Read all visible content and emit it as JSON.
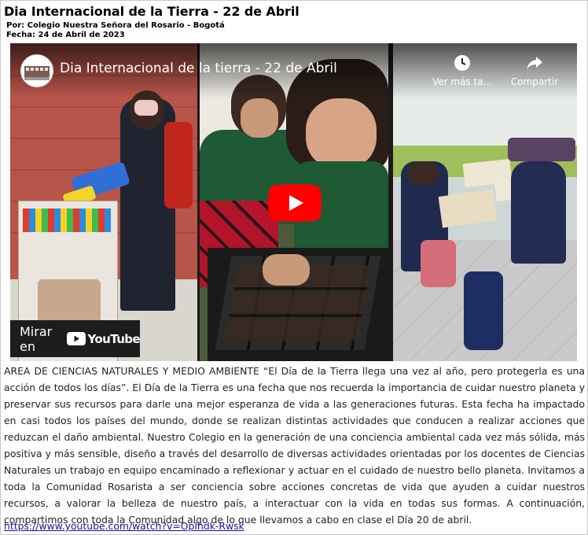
{
  "article": {
    "title": "Dia Internacional de la Tierra - 22 de Abril",
    "author": "Por: Colegio Nuestra Señora del Rosario - Bogotá",
    "date": "Fecha: 24 de Abril de 2023",
    "body": "AREA DE CIENCIAS NATURALES Y MEDIO AMBIENTE “El Día de la Tierra llega una vez al año, pero protegerla es una acción de todos los días”. El Día de la Tierra es una fecha que nos recuerda la importancia de cuidar nuestro planeta y preservar sus recursos para darle una mejor esperanza de vida a las generaciones futuras. Esta fecha ha impactado en casi todos los países del mundo, donde se realizan distintas actividades que conducen a realizar acciones que reduzcan el daño ambiental. Nuestro Colegio en la generación de una conciencia ambiental cada vez más sólida, más positiva y más sensible, diseño a través del desarrollo de diversas actividades orientadas por los docentes de Ciencias Naturales un trabajo en equipo encaminado a reflexionar y actuar en el cuidado de nuestro bello planeta. Invitamos a toda la Comunidad Rosarista a ser conciencia sobre acciones concretas de vida que ayuden a cuidar nuestros recursos, a valorar la belleza de nuestro país, a interactuar con la vida en todas sus formas. A continuación, compartimos con toda la Comunidad algo de lo que llevamos a cabo en clase el Día 20 de abril.",
    "link": "https://www.youtube.com/watch?v=OpIhdk-Rwsk"
  },
  "video": {
    "title": "Dia Internacional de la tierra - 22 de Abril",
    "watch_later_label": "Ver más ta...",
    "share_label": "Compartir",
    "watch_on_label": "Mirar en",
    "youtube_word": "YouTube",
    "icons": [
      "channel-avatar",
      "clock-icon",
      "share-icon",
      "play-icon",
      "youtube-logo-icon"
    ]
  },
  "colors": {
    "youtube_red": "#ff0000",
    "link": "#1a0dab"
  }
}
